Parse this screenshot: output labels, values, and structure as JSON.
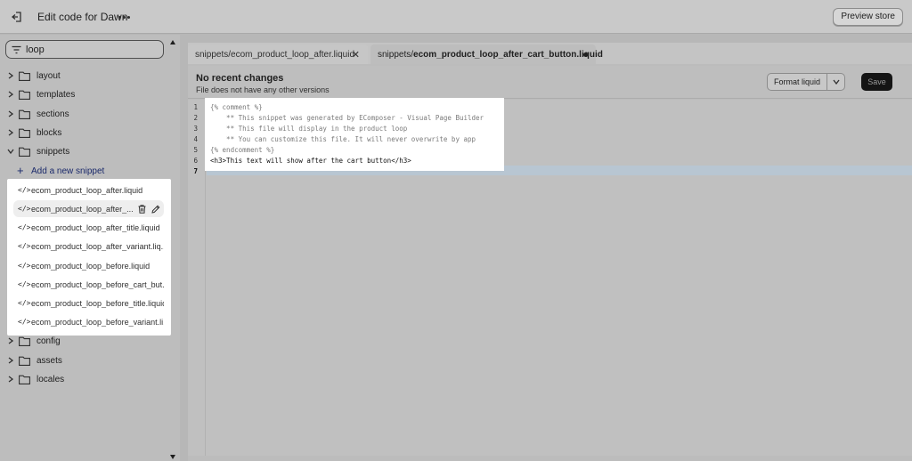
{
  "topbar": {
    "title": "Edit code for Dawn",
    "preview_label": "Preview store"
  },
  "sidebar": {
    "search": {
      "value": "loop",
      "placeholder": ""
    },
    "folders_top": [
      {
        "label": "layout",
        "expanded": false
      },
      {
        "label": "templates",
        "expanded": false
      },
      {
        "label": "sections",
        "expanded": false
      },
      {
        "label": "blocks",
        "expanded": false
      },
      {
        "label": "snippets",
        "expanded": true
      }
    ],
    "add_snippet_label": "Add a new snippet",
    "snippets": [
      {
        "label": "ecom_product_loop_after.liquid"
      },
      {
        "label": "ecom_product_loop_after_...",
        "active": true
      },
      {
        "label": "ecom_product_loop_after_title.liquid"
      },
      {
        "label": "ecom_product_loop_after_variant.liq..."
      },
      {
        "label": "ecom_product_loop_before.liquid"
      },
      {
        "label": "ecom_product_loop_before_cart_but..."
      },
      {
        "label": "ecom_product_loop_before_title.liquid"
      },
      {
        "label": "ecom_product_loop_before_variant.li..."
      }
    ],
    "folders_bottom": [
      {
        "label": "config",
        "expanded": false
      },
      {
        "label": "assets",
        "expanded": false
      },
      {
        "label": "locales",
        "expanded": false
      }
    ]
  },
  "tabs": [
    {
      "label": "snippets/ecom_product_loop_after.liquid",
      "active": false
    },
    {
      "label_prefix": "snippets/",
      "label_file": "ecom_product_loop_after_cart_button.liquid",
      "active": true,
      "unsaved": true
    }
  ],
  "editor_header": {
    "status_title": "No recent changes",
    "status_sub": "File does not have any other versions",
    "format_label": "Format liquid",
    "save_label": "Save"
  },
  "code": {
    "current_line": 7,
    "lines": [
      {
        "n": "1",
        "text": "{% comment %}"
      },
      {
        "n": "2",
        "text": "    ** This snippet was generated by EComposer - Visual Page Builder"
      },
      {
        "n": "3",
        "text": "    ** This file will display in the product loop"
      },
      {
        "n": "4",
        "text": "    ** You can customize this file. It will never overwrite by app"
      },
      {
        "n": "5",
        "text": "{% endcomment %}"
      },
      {
        "n": "6",
        "text": "<h3>This text will show after the cart button</h3>"
      },
      {
        "n": "7",
        "text": ""
      }
    ]
  },
  "icons": {
    "exit": "exit-icon",
    "more": "more-horizontal-icon",
    "filter": "filter-icon",
    "chevron": "chevron-right-icon",
    "folder": "folder-icon",
    "code": "code-file-icon",
    "delete": "trash-icon",
    "rename": "pencil-icon"
  },
  "colors": {
    "save_button": "#151515",
    "add_snippet_link": "#1b2a6b",
    "highlight": "#ffffff"
  }
}
